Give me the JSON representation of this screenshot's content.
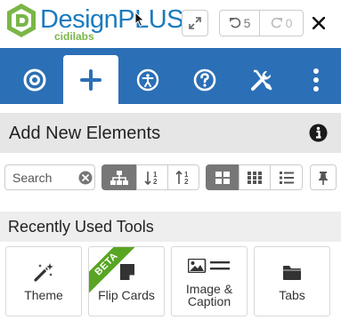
{
  "header": {
    "logo_brand": "DesignPLUS",
    "logo_sub": "cidilabs",
    "undo_count": "5",
    "redo_count": "0"
  },
  "toolbar": {
    "tabs": [
      {
        "icon": "target-icon",
        "active": false
      },
      {
        "icon": "plus-icon",
        "active": true
      },
      {
        "icon": "accessibility-icon",
        "active": false
      },
      {
        "icon": "question-circle-icon",
        "active": false
      },
      {
        "icon": "tools-icon",
        "active": false
      },
      {
        "icon": "more-vertical-icon",
        "active": false
      }
    ]
  },
  "section": {
    "title": "Add New Elements"
  },
  "search": {
    "placeholder": "Search",
    "value": ""
  },
  "recent": {
    "title": "Recently Used Tools",
    "cards": [
      {
        "label": "Theme",
        "icon": "magic-wand-icon"
      },
      {
        "label": "Flip Cards",
        "icon": "flip-card-icon",
        "badge": "BETA"
      },
      {
        "label_line1": "Image &",
        "label_line2": "Caption",
        "icon": "image-caption-icon"
      },
      {
        "label": "Tabs",
        "icon": "folder-tab-icon"
      }
    ]
  },
  "colors": {
    "toolbar_blue": "#2b6fb6",
    "brand_green": "#7ab648",
    "beta_green": "#58a523",
    "active_gray": "#777777"
  }
}
